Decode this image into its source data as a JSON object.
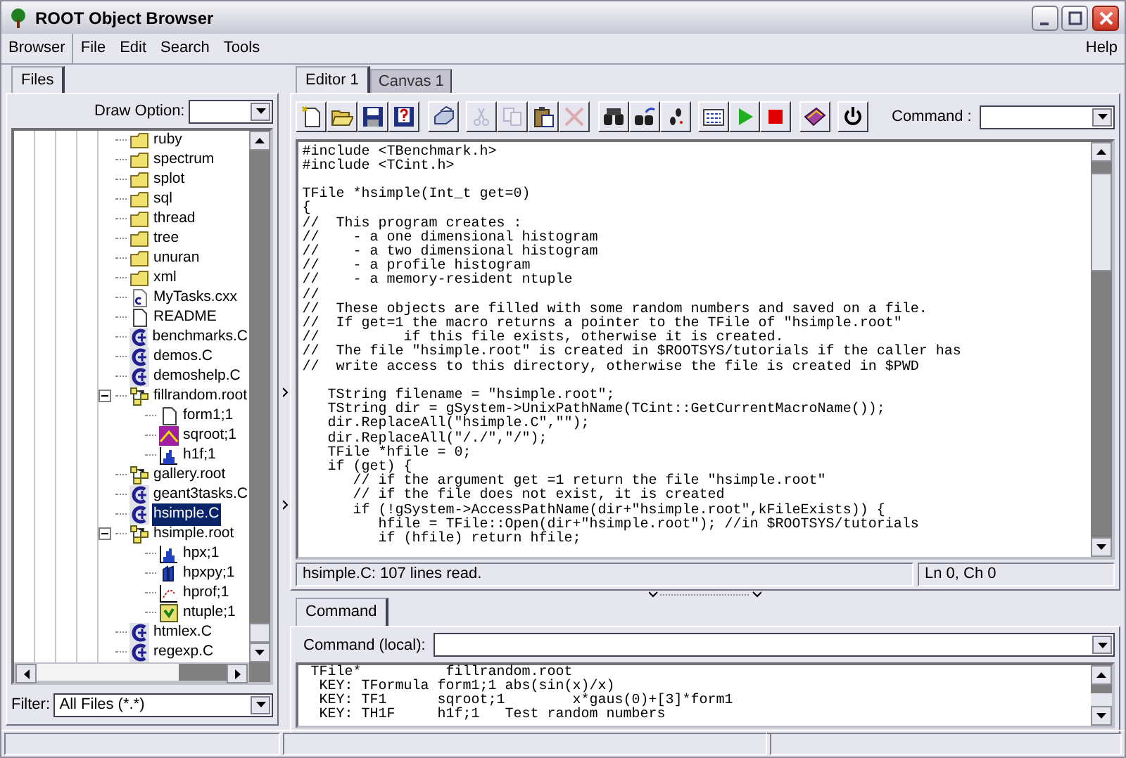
{
  "window": {
    "title": "ROOT Object Browser"
  },
  "menu": {
    "browser": "Browser",
    "items": [
      "File",
      "Edit",
      "Search",
      "Tools"
    ],
    "help": "Help"
  },
  "left_panel": {
    "tabs": [
      {
        "label": "Files",
        "selected": true
      }
    ],
    "draw_option": {
      "label": "Draw Option:"
    },
    "tree": [
      {
        "label": "ruby",
        "kind": "folder",
        "selected": false
      },
      {
        "label": "spectrum",
        "kind": "folder",
        "selected": false
      },
      {
        "label": "splot",
        "kind": "folder",
        "selected": false
      },
      {
        "label": "sql",
        "kind": "folder",
        "selected": false
      },
      {
        "label": "thread",
        "kind": "folder",
        "selected": false
      },
      {
        "label": "tree",
        "kind": "folder",
        "selected": false
      },
      {
        "label": "unuran",
        "kind": "folder",
        "selected": false
      },
      {
        "label": "xml",
        "kind": "folder",
        "selected": false
      },
      {
        "label": "MyTasks.cxx",
        "kind": "cxx",
        "selected": false
      },
      {
        "label": "README",
        "kind": "file",
        "selected": false
      },
      {
        "label": "benchmarks.C",
        "kind": "macro",
        "selected": false
      },
      {
        "label": "demos.C",
        "kind": "macro",
        "selected": false
      },
      {
        "label": "demoshelp.C",
        "kind": "macro",
        "selected": false
      },
      {
        "label": "fillrandom.root",
        "kind": "rootfile",
        "selected": false,
        "expanded": true,
        "children": [
          {
            "label": "form1;1",
            "kind": "file",
            "selected": false
          },
          {
            "label": "sqroot;1",
            "kind": "function",
            "selected": false
          },
          {
            "label": "h1f;1",
            "kind": "hist1",
            "selected": false
          }
        ]
      },
      {
        "label": "gallery.root",
        "kind": "rootfile",
        "selected": false
      },
      {
        "label": "geant3tasks.C",
        "kind": "macro",
        "selected": false
      },
      {
        "label": "hsimple.C",
        "kind": "macro",
        "selected": true
      },
      {
        "label": "hsimple.root",
        "kind": "rootfile",
        "selected": false,
        "expanded": true,
        "children": [
          {
            "label": "hpx;1",
            "kind": "hist1",
            "selected": false
          },
          {
            "label": "hpxpy;1",
            "kind": "hist2",
            "selected": false
          },
          {
            "label": "hprof;1",
            "kind": "profile",
            "selected": false
          },
          {
            "label": "ntuple;1",
            "kind": "ntuple",
            "selected": false
          }
        ]
      },
      {
        "label": "htmlex.C",
        "kind": "macro",
        "selected": false
      },
      {
        "label": "regexp.C",
        "kind": "macro",
        "selected": false
      }
    ],
    "filter": {
      "label": "Filter:",
      "value": "All Files (*.*)"
    }
  },
  "right_panel": {
    "tabs": [
      {
        "label": "Editor 1",
        "selected": true
      },
      {
        "label": "Canvas 1",
        "selected": false
      }
    ],
    "toolbar": [
      [
        {
          "kind": "new",
          "disabled": false
        },
        {
          "kind": "open",
          "disabled": false
        },
        {
          "kind": "save",
          "disabled": false
        },
        {
          "kind": "saveas",
          "disabled": false
        }
      ],
      [
        {
          "kind": "print",
          "disabled": false
        }
      ],
      [
        {
          "kind": "cut",
          "disabled": true
        },
        {
          "kind": "copy",
          "disabled": true
        },
        {
          "kind": "paste",
          "disabled": false
        },
        {
          "kind": "delete",
          "disabled": true
        }
      ],
      [
        {
          "kind": "find",
          "disabled": false
        },
        {
          "kind": "findagain",
          "disabled": false
        },
        {
          "kind": "goto",
          "disabled": false
        }
      ],
      [
        {
          "kind": "compile",
          "disabled": false
        },
        {
          "kind": "execute",
          "disabled": false
        },
        {
          "kind": "interrupt",
          "disabled": false
        }
      ],
      [
        {
          "kind": "help",
          "disabled": false
        }
      ],
      [
        {
          "kind": "quit",
          "disabled": false
        }
      ]
    ],
    "command": {
      "label": "Command :"
    },
    "code_blocks": [
      [
        "#include <TBenchmark.h>",
        "#include <TCint.h>"
      ],
      [
        "TFile *hsimple(Int_t get=0)",
        "{",
        "//  This program creates :",
        "//    - a one dimensional histogram",
        "//    - a two dimensional histogram",
        "//    - a profile histogram",
        "//    - a memory-resident ntuple",
        "//",
        "//  These objects are filled with some random numbers and saved on a file.",
        "//  If get=1 the macro returns a pointer to the TFile of \"hsimple.root\"",
        "//          if this file exists, otherwise it is created.",
        "//  The file \"hsimple.root\" is created in $ROOTSYS/tutorials if the caller has",
        "//  write access to this directory, otherwise the file is created in $PWD"
      ],
      [
        "   TString filename = \"hsimple.root\";",
        "   TString dir = gSystem->UnixPathName(TCint::GetCurrentMacroName());",
        "   dir.ReplaceAll(\"hsimple.C\",\"\");",
        "   dir.ReplaceAll(\"/./\",\"/\");",
        "   TFile *hfile = 0;",
        "   if (get) {",
        "      // if the argument get =1 return the file \"hsimple.root\"",
        "      // if the file does not exist, it is created",
        "      if (!gSystem->AccessPathName(dir+\"hsimple.root\",kFileExists)) {",
        "         hfile = TFile::Open(dir+\"hsimple.root\"); //in $ROOTSYS/tutorials",
        "         if (hfile) return hfile;"
      ]
    ],
    "status": {
      "message": "hsimple.C: 107 lines read.",
      "position": "Ln 0, Ch 0"
    },
    "bottom_tabs": [
      {
        "label": "Command",
        "selected": true
      }
    ],
    "local_command": {
      "label": "Command (local):"
    },
    "output": [
      " TFile*          fillrandom.root",
      "  KEY: TFormula form1;1 abs(sin(x)/x)",
      "  KEY: TF1      sqroot;1        x*gaus(0)+[3]*form1",
      "  KEY: TH1F     h1f;1   Test random numbers"
    ]
  }
}
